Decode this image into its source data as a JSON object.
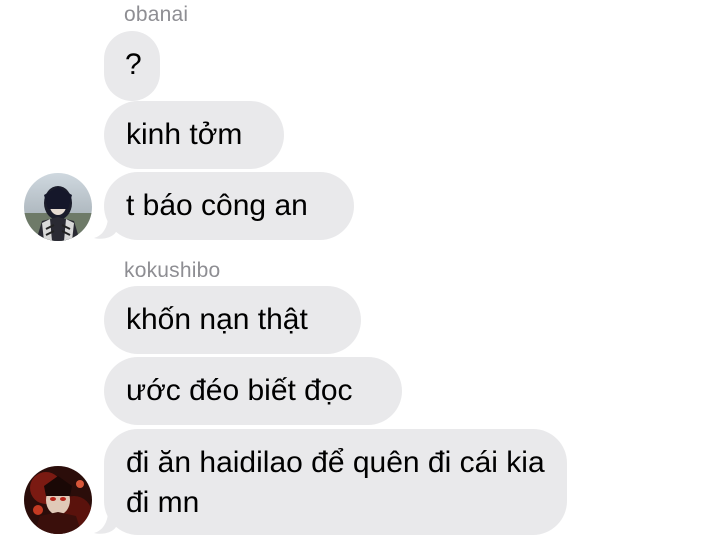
{
  "conversation": {
    "groups": [
      {
        "sender": "obanai",
        "avatar_icon": "obanai-avatar-icon",
        "messages": [
          "?",
          "kinh tởm",
          "t báo công an"
        ]
      },
      {
        "sender": "kokushibo",
        "avatar_icon": "kokushibo-avatar-icon",
        "messages": [
          "khốn nạn thật",
          "ước đéo biết đọc",
          "đi ăn haidilao để quên đi cái kia đi mn"
        ]
      }
    ]
  },
  "colors": {
    "bubble": "#e9e9eb",
    "sender_label": "#8e8e93",
    "text": "#000000",
    "background": "#ffffff"
  }
}
